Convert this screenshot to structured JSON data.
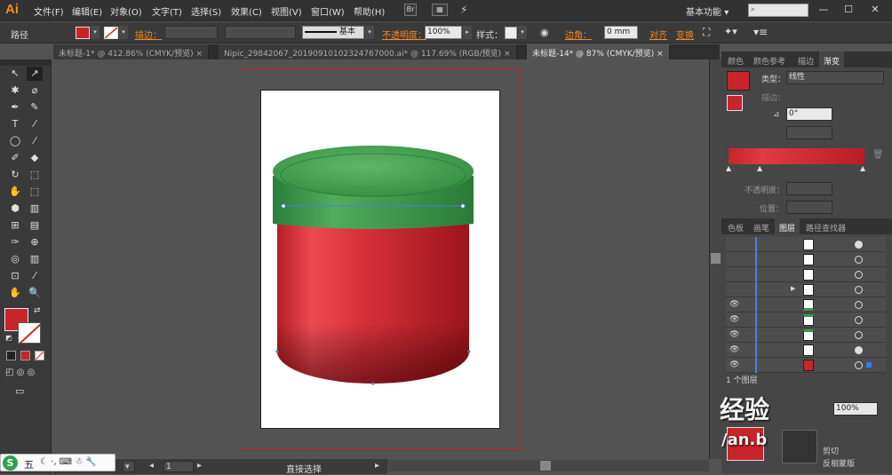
{
  "app": {
    "logo": "Ai",
    "workspace": "基本功能",
    "workspace_arrow": "▾",
    "bridge": "Br",
    "arrange": "▦",
    "min": "—",
    "max": "☐",
    "close": "✕"
  },
  "menu": [
    "文件(F)",
    "编辑(E)",
    "对象(O)",
    "文字(T)",
    "选择(S)",
    "效果(C)",
    "视图(V)",
    "窗口(W)",
    "帮助(H)"
  ],
  "control": {
    "selection_label": "路径",
    "stroke_label": "描边：",
    "stroke_style": "基本",
    "opacity_label": "不透明度：",
    "opacity_value": "100%",
    "style_label": "样式：",
    "corner_label": "边角：",
    "corner_value": "0 mm",
    "align_label": "对齐",
    "transform_label": "变换"
  },
  "tabs": [
    {
      "label": "未标题-1* @ 412.86% (CMYK/预览)",
      "close": "×",
      "active": false
    },
    {
      "label": "Nipic_29842067_20190910102324767000.ai* @ 117.69% (RGB/预览)",
      "close": "×",
      "active": false
    },
    {
      "label": "未标题-14* @ 87% (CMYK/预览)",
      "close": "×",
      "active": true
    }
  ],
  "tools": [
    "↖",
    "↗",
    "✱",
    "⌀",
    "✒",
    "✎",
    "T",
    "⁄",
    "◯",
    "⁄",
    "✐",
    "◆",
    "↻",
    "⬚",
    "✋",
    "⬚",
    "⬢",
    "▥",
    "⊞",
    "▤",
    "✑",
    "⊕",
    "◎",
    "▥",
    "⊡",
    "⁄",
    "✋",
    "🔍"
  ],
  "gradient_panel": {
    "tabs": [
      "颜色",
      "颜色参考",
      "描边",
      "渐变"
    ],
    "type_label": "类型：",
    "type_value": "线性",
    "stroke_label": "描边：",
    "angle_value": "0°",
    "opacity_label": "不透明度：",
    "position_label": "位置："
  },
  "layers_panel": {
    "tabs": [
      "色板",
      "画笔",
      "图层",
      "路径查找器"
    ],
    "count": "1 个图层",
    "rows": 8
  },
  "status": {
    "zoom": "87%",
    "page": "1",
    "tool": "直接选择"
  },
  "bottom_panel": {
    "opacity_value": "100%",
    "clip_label": "剪切",
    "invert_label": "反相蒙版"
  },
  "watermark": {
    "text1": "经验",
    "text2": "/an.b"
  },
  "taskbar": {
    "logo": "S",
    "ime": "五"
  },
  "colors": {
    "accent": "#f08a24",
    "fill": "#c8242b",
    "lid": "#3f9c4e"
  }
}
